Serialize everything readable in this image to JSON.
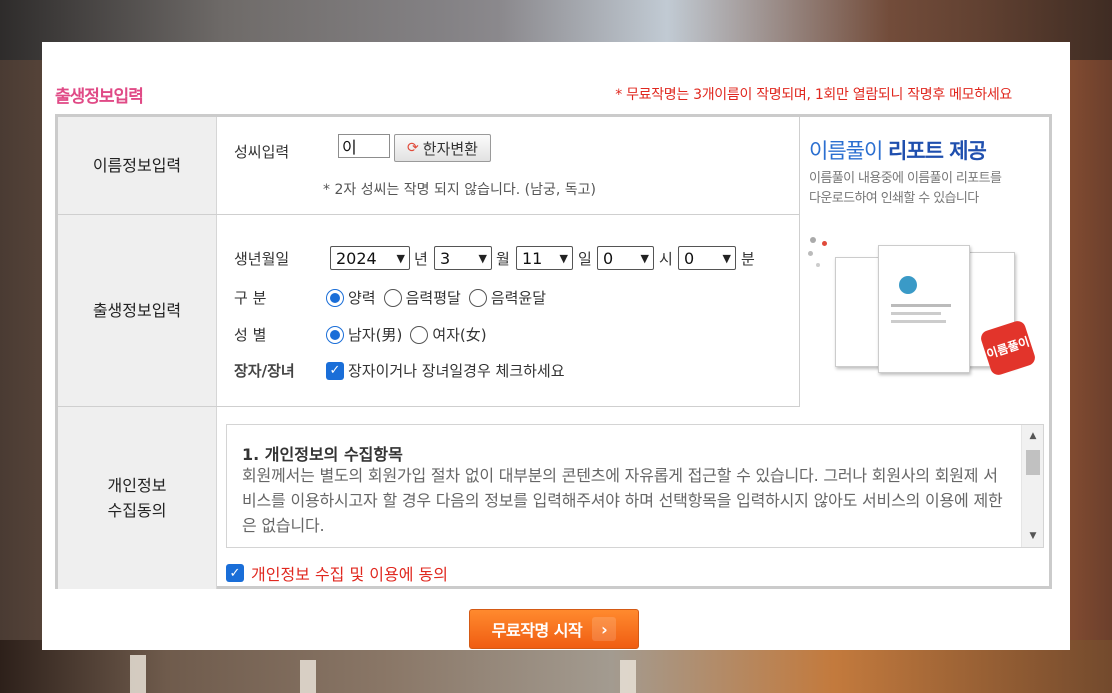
{
  "header": {
    "title": "출생정보입력",
    "notice": "* 무료작명는 3개이름이 작명되며, 1회만 열람되니 작명후 메모하세요"
  },
  "name_section": {
    "label": "이름정보입력",
    "surname_label": "성씨입력",
    "surname_value": "이",
    "hanja_button": "한자변환",
    "hint": "* 2자 성씨는 작명 되지 않습니다. (남궁, 독고)"
  },
  "birth_section": {
    "label": "출생정보입력",
    "birthdate_label": "생년월일",
    "year": "2024",
    "year_unit": "년",
    "month": "3",
    "month_unit": "월",
    "day": "11",
    "day_unit": "일",
    "hour": "0",
    "hour_unit": "시",
    "minute": "0",
    "minute_unit": "분",
    "calendar_label": "구 분",
    "calendar_options": [
      "양력",
      "음력평달",
      "음력윤달"
    ],
    "calendar_selected": "양력",
    "gender_label": "성 별",
    "gender_options": [
      "남자(男)",
      "여자(女)"
    ],
    "gender_selected": "남자(男)",
    "eldest_label": "장자/장녀",
    "eldest_checkbox_text": "장자이거나 장녀일경우 체크하세요",
    "eldest_checked": true
  },
  "promo": {
    "heading_normal": "이름풀이 ",
    "heading_bold": "리포트 제공",
    "sub_line1": "이름풀이 내용중에 이름풀이 리포트를",
    "sub_line2": "다운로드하여 인쇄할 수 있습니다",
    "badge": "이름풀이"
  },
  "privacy_section": {
    "label_line1": "개인정보",
    "label_line2": "수집동의",
    "box_title": "1. 개인정보의 수집항목",
    "box_body": "회원께서는 별도의 회원가입 절차 없이 대부분의 콘텐츠에 자유롭게 접근할 수 있습니다. 그러나 회원사의 회원제 서비스를 이용하시고자 할 경우 다음의 정보를 입력해주셔야 하며 선택항목을 입력하시지 않아도 서비스의 이용에 제한은 없습니다.",
    "agree_text": "개인정보 수집 및 이용에 동의",
    "agree_checked": true
  },
  "start_button": "무료작명 시작",
  "colors": {
    "title_pink": "#e04a86",
    "notice_red": "#e0281f",
    "accent_blue": "#1a6ed8",
    "button_orange": "#f05d12"
  }
}
